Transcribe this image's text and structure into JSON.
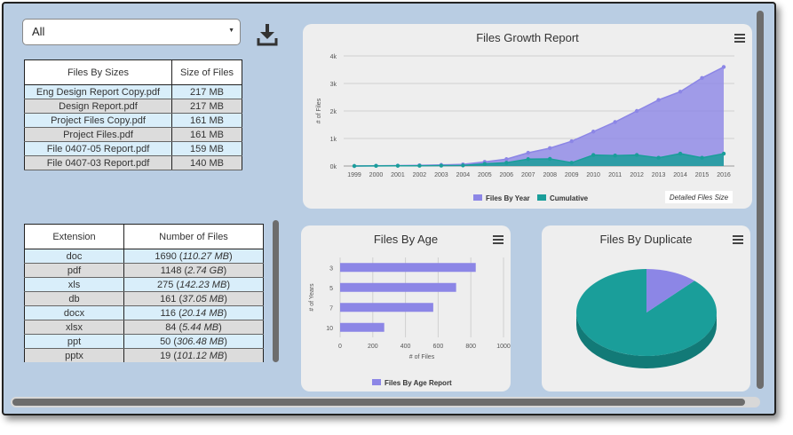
{
  "filter": {
    "selected": "All"
  },
  "icons": {
    "download": "download-icon",
    "menu": "hamburger-menu-icon"
  },
  "files_by_sizes": {
    "headers": [
      "Files By Sizes",
      "Size of Files"
    ],
    "rows": [
      [
        "Eng Design Report Copy.pdf",
        "217 MB"
      ],
      [
        "Design Report.pdf",
        "217 MB"
      ],
      [
        "Project Files Copy.pdf",
        "161 MB"
      ],
      [
        "Project Files.pdf",
        "161 MB"
      ],
      [
        "File 0407-05 Report.pdf",
        "159 MB"
      ],
      [
        "File 0407-03 Report.pdf",
        "140 MB"
      ]
    ]
  },
  "extensions": {
    "headers": [
      "Extension",
      "Number of Files"
    ],
    "rows": [
      [
        "doc",
        "1690",
        "110.27 MB"
      ],
      [
        "pdf",
        "1148",
        "2.74 GB"
      ],
      [
        "xls",
        "275",
        "142.23 MB"
      ],
      [
        "db",
        "161",
        "37.05 MB"
      ],
      [
        "docx",
        "116",
        "20.14 MB"
      ],
      [
        "xlsx",
        "84",
        "5.44 MB"
      ],
      [
        "ppt",
        "50",
        "306.48 MB"
      ],
      [
        "pptx",
        "19",
        "101.12 MB"
      ]
    ]
  },
  "colors": {
    "purple": "#8c86e6",
    "teal": "#1a9e9a",
    "panel": "#eeeeee",
    "bg": "#b9cde3"
  },
  "chart_data": [
    {
      "type": "area",
      "title": "Files Growth Report",
      "ylabel": "# of Files",
      "x": [
        "1999",
        "2000",
        "2001",
        "2002",
        "2003",
        "2004",
        "2005",
        "2006",
        "2007",
        "2008",
        "2009",
        "2010",
        "2011",
        "2012",
        "2013",
        "2014",
        "2015",
        "2016"
      ],
      "yticks": [
        "0k",
        "1k",
        "2k",
        "3k",
        "4k"
      ],
      "ylim": [
        0,
        4000
      ],
      "series": [
        {
          "name": "Files By Year",
          "values": [
            0,
            10,
            15,
            25,
            40,
            60,
            150,
            250,
            480,
            650,
            900,
            1250,
            1600,
            2000,
            2400,
            2700,
            3200,
            3600
          ]
        },
        {
          "name": "Cumulative",
          "values": [
            0,
            5,
            8,
            10,
            15,
            20,
            80,
            120,
            250,
            260,
            120,
            400,
            380,
            400,
            300,
            450,
            300,
            450
          ]
        }
      ],
      "legend": "bottom-center",
      "extra_label": "Detailed Files Size"
    },
    {
      "type": "bar",
      "orientation": "horizontal",
      "title": "Files By Age",
      "ylabel": "# of Years",
      "xlabel": "# of Files",
      "categories": [
        "3",
        "5",
        "7",
        "10"
      ],
      "values": [
        830,
        710,
        570,
        270
      ],
      "xticks": [
        "0",
        "200",
        "400",
        "600",
        "800",
        "1000"
      ],
      "xlim": [
        0,
        1000
      ],
      "series_name": "Files By Age Report"
    },
    {
      "type": "pie",
      "title": "Files By Duplicate",
      "values": [
        88,
        12
      ]
    }
  ]
}
